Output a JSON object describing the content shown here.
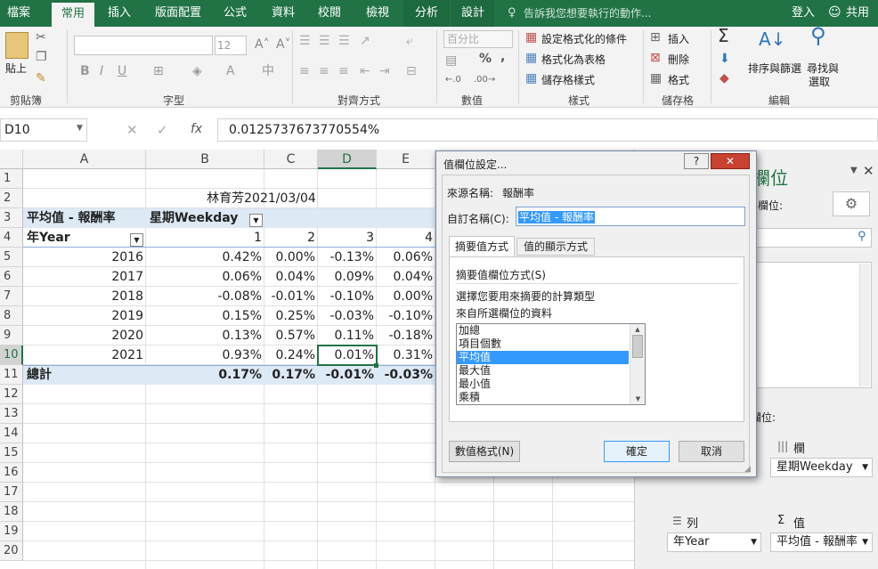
{
  "tabs": {
    "file": "檔案",
    "home": "常用",
    "insert": "插入",
    "layout": "版面配置",
    "formulas": "公式",
    "data": "資料",
    "review": "校閱",
    "view": "檢視",
    "analyze": "分析",
    "design": "設計",
    "tellme": "告訴我您想要執行的動作...",
    "signin": "登入",
    "share": "共用"
  },
  "ribbon": {
    "clipboard": {
      "paste": "貼上",
      "label": "剪貼簿"
    },
    "font": {
      "name": "",
      "size": "12",
      "label": "字型",
      "bold": "B",
      "italic": "I",
      "underline": "U"
    },
    "alignment": {
      "label": "對齊方式"
    },
    "number": {
      "format": "百分比",
      "label": "數值",
      "percent": "%",
      "comma": ","
    },
    "styles": {
      "cond": "設定格式化的條件",
      "table": "格式化為表格",
      "cell": "儲存格樣式",
      "label": "樣式"
    },
    "cells": {
      "insert": "插入",
      "delete": "刪除",
      "format": "格式",
      "label": "儲存格"
    },
    "editing": {
      "sort": "排序與篩選",
      "find1": "尋找與",
      "find2": "選取",
      "label": "編輯"
    }
  },
  "formula_bar": {
    "name_box": "D10",
    "formula": "0.0125737673770554%"
  },
  "columns": [
    "A",
    "B",
    "C",
    "D",
    "E"
  ],
  "rows": [
    "1",
    "2",
    "3",
    "4",
    "5",
    "6",
    "7",
    "8",
    "9",
    "10",
    "11",
    "12",
    "13",
    "14",
    "15",
    "16",
    "17",
    "18",
    "19",
    "20"
  ],
  "sheet": {
    "title": "林育芳2021/03/04",
    "pivot_value": "平均值 - 報酬率",
    "col_field": "星期Weekday",
    "row_field": "年Year",
    "col_labels": [
      "1",
      "2",
      "3",
      "4"
    ],
    "data_rows": [
      {
        "year": "2016",
        "v": [
          "0.42%",
          "0.00%",
          "-0.13%",
          "0.06%"
        ]
      },
      {
        "year": "2017",
        "v": [
          "0.06%",
          "0.04%",
          "0.09%",
          "0.04%"
        ]
      },
      {
        "year": "2018",
        "v": [
          "-0.08%",
          "-0.01%",
          "-0.10%",
          "0.00%"
        ]
      },
      {
        "year": "2019",
        "v": [
          "0.15%",
          "0.25%",
          "-0.03%",
          "-0.10%"
        ]
      },
      {
        "year": "2020",
        "v": [
          "0.13%",
          "0.57%",
          "0.11%",
          "-0.18%"
        ]
      },
      {
        "year": "2021",
        "v": [
          "0.93%",
          "0.24%",
          "0.01%",
          "0.31%"
        ]
      }
    ],
    "total_label": "總計",
    "totals": [
      "0.17%",
      "0.17%",
      "-0.01%",
      "-0.03%"
    ]
  },
  "pane": {
    "title": "欄位",
    "choose_label": "欄位:",
    "drag_label": "欄位:",
    "columns_label": "欄",
    "columns_item": "星期Weekday",
    "rows_label": "列",
    "rows_item": "年Year",
    "values_label": "值",
    "values_item": "平均值 - 報酬率",
    "sigma": "Σ"
  },
  "dialog": {
    "title": "值欄位設定...",
    "source_label": "來源名稱:",
    "source_value": "報酬率",
    "custom_label": "自訂名稱(C):",
    "custom_value": "平均值 - 報酬率",
    "tab1": "摘要值方式",
    "tab2": "值的顯示方式",
    "section": "摘要值欄位方式(S)",
    "desc1": "選擇您要用來摘要的計算類型",
    "desc2": "來自所選欄位的資料",
    "options": [
      "加總",
      "項目個數",
      "平均值",
      "最大值",
      "最小值",
      "乘積"
    ],
    "selected": "平均值",
    "number_format_btn": "數值格式(N)",
    "ok": "確定",
    "cancel": "取消",
    "help": "?",
    "close": "✕"
  }
}
